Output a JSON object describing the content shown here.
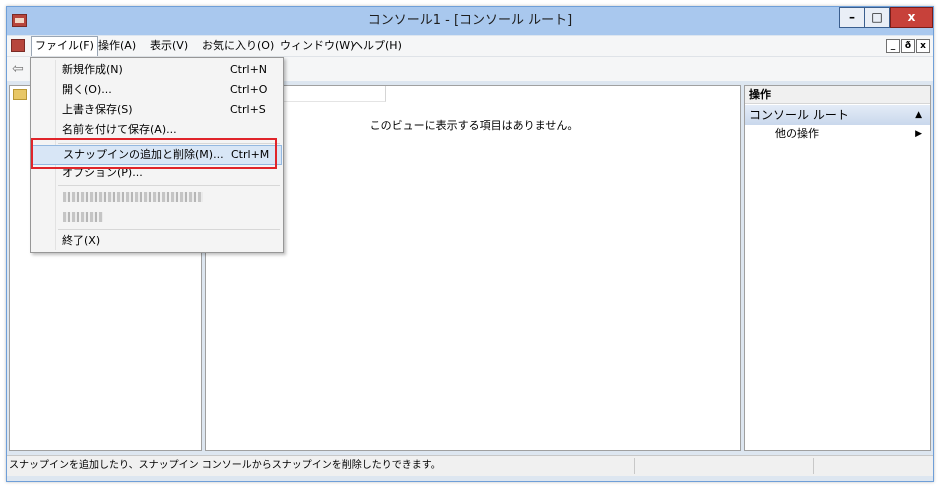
{
  "window": {
    "title": "コンソール1 - [コンソール ルート]",
    "caption": {
      "minimize": "–",
      "maximize": "□",
      "close": "x"
    }
  },
  "menubar": {
    "items": [
      "ファイル(F)",
      "操作(A)",
      "表示(V)",
      "お気に入り(O)",
      "ウィンドウ(W)",
      "ヘルプ(H)"
    ],
    "mdi": {
      "minimize": "_",
      "restore": "ð",
      "close": "x"
    }
  },
  "file_menu": {
    "new": {
      "label": "新規作成(N)",
      "shortcut": "Ctrl+N"
    },
    "open": {
      "label": "開く(O)...",
      "shortcut": "Ctrl+O"
    },
    "save": {
      "label": "上書き保存(S)",
      "shortcut": "Ctrl+S"
    },
    "save_as": {
      "label": "名前を付けて保存(A)..."
    },
    "add_remove_snapin": {
      "label": "スナップインの追加と削除(M)...",
      "shortcut": "Ctrl+M"
    },
    "options": {
      "label": "オプション(P)..."
    },
    "exit": {
      "label": "終了(X)"
    }
  },
  "center": {
    "empty_message": "このビューに表示する項目はありません。"
  },
  "actions": {
    "title": "操作",
    "section": "コンソール ルート",
    "more_actions": "他の操作"
  },
  "statusbar": {
    "text": "スナップインを追加したり、スナップイン コンソールからスナップインを削除したりできます。"
  }
}
